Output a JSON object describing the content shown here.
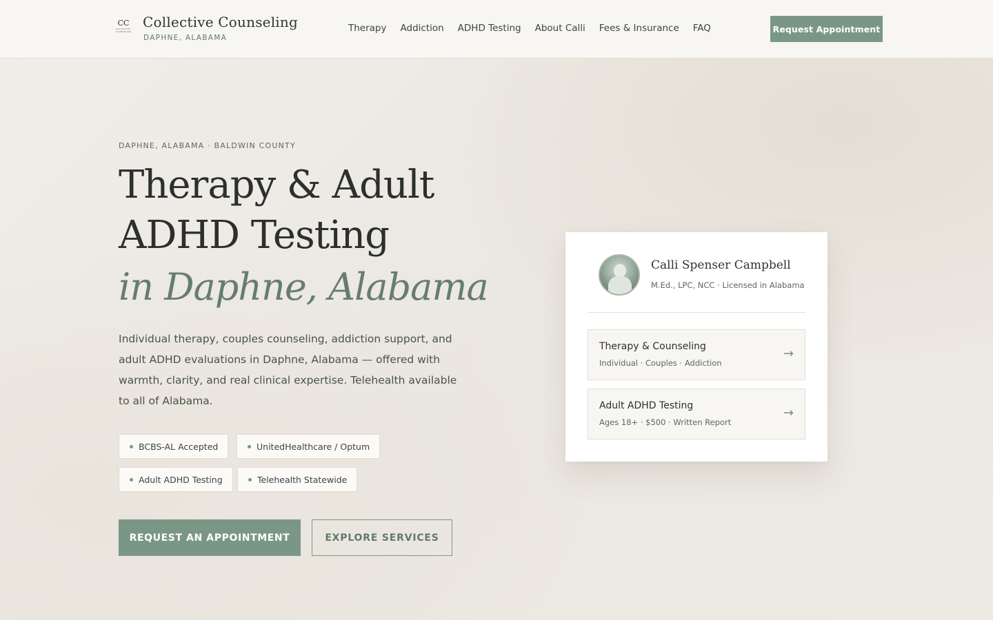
{
  "header": {
    "brand": {
      "name": "Collective Counseling",
      "location": "DAPHNE, ALABAMA",
      "mark_text": "CC",
      "mark_subtext": "COLLECTIVE COUNSELING"
    },
    "nav": [
      "Therapy",
      "Addiction",
      "ADHD Testing",
      "About Calli",
      "Fees & Insurance",
      "FAQ"
    ],
    "cta_label": "Request Appointment"
  },
  "hero": {
    "eyebrow": "DAPHNE, ALABAMA · BALDWIN COUNTY",
    "title_line1": "Therapy & Adult",
    "title_line2": "ADHD Testing",
    "title_italic": "in Daphne, Alabama",
    "lead": "Individual therapy, couples counseling, addiction support, and adult ADHD evaluations in Daphne, Alabama — offered with warmth, clarity, and real clinical expertise. Telehealth available to all of Alabama.",
    "tags": [
      "BCBS-AL Accepted",
      "UnitedHealthcare / Optum",
      "Adult ADHD Testing",
      "Telehealth Statewide"
    ],
    "primary_cta": "Request an Appointment",
    "secondary_cta": "Explore Services"
  },
  "card": {
    "name": "Calli Spenser Campbell",
    "credentials": "M.Ed., LPC, NCC  ·  Licensed in Alabama",
    "services": [
      {
        "title": "Therapy & Counseling",
        "subtitle": "Individual · Couples · Addiction",
        "arrow": "→"
      },
      {
        "title": "Adult ADHD Testing",
        "subtitle": "Ages 18+ · $500 · Written Report",
        "arrow": "→"
      }
    ]
  },
  "colors": {
    "accent": "#7a9785",
    "accent_text": "#5f7a6b",
    "italic_heading": "#657d6f",
    "header_bg": "#f8f6f2"
  }
}
